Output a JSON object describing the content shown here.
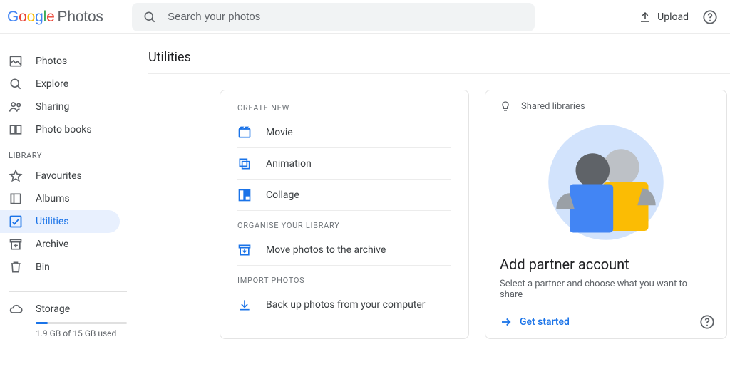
{
  "header": {
    "logo_product": "Photos",
    "search_placeholder": "Search your photos",
    "upload_label": "Upload"
  },
  "sidebar": {
    "items_main": [
      {
        "label": "Photos",
        "icon": "image-icon"
      },
      {
        "label": "Explore",
        "icon": "search-icon"
      },
      {
        "label": "Sharing",
        "icon": "people-icon"
      },
      {
        "label": "Photo books",
        "icon": "book-icon"
      }
    ],
    "library_label": "LIBRARY",
    "items_lib": [
      {
        "label": "Favourites",
        "icon": "star-icon"
      },
      {
        "label": "Albums",
        "icon": "album-icon"
      },
      {
        "label": "Utilities",
        "icon": "utilities-icon",
        "selected": true
      },
      {
        "label": "Archive",
        "icon": "archive-icon"
      },
      {
        "label": "Bin",
        "icon": "trash-icon"
      }
    ],
    "storage": {
      "label": "Storage",
      "detail": "1.9 GB of 15 GB used"
    }
  },
  "main": {
    "title": "Utilities",
    "create_label": "CREATE NEW",
    "create_items": [
      {
        "label": "Movie"
      },
      {
        "label": "Animation"
      },
      {
        "label": "Collage"
      }
    ],
    "organise_label": "ORGANISE YOUR LIBRARY",
    "organise_item": "Move photos to the archive",
    "import_label": "IMPORT PHOTOS",
    "import_item": "Back up photos from your computer"
  },
  "promo": {
    "tip_label": "Shared libraries",
    "title": "Add partner account",
    "subtitle": "Select a partner and choose what you want to share",
    "cta": "Get started"
  }
}
